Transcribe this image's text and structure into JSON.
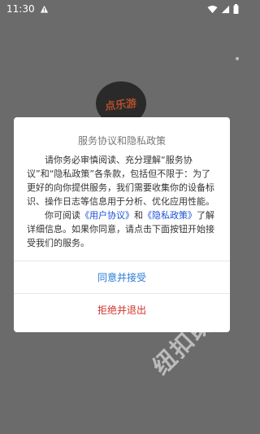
{
  "status_bar": {
    "time": "11:30",
    "icons": [
      "warning-icon",
      "wifi-icon",
      "signal-icon",
      "battery-icon"
    ]
  },
  "app": {
    "logo_text": "点乐游"
  },
  "dialog": {
    "title": "服务协议和隐私政策",
    "para1": "请你务必审慎阅读、充分理解“服务协议”和“隐私政策”各条款，包括但不限于：为了更好的向你提供服务，我们需要收集你的设备标识、操作日志等信息用于分析、优化应用性能。",
    "para2_prefix": "你可阅读",
    "user_agreement_link": "《用户协议》",
    "para2_and": "和",
    "privacy_policy_link": "《隐私政策》",
    "para2_suffix": "了解详细信息。如果你同意，请点击下面按钮开始接受我们的服务。",
    "agree_button": "同意并接受",
    "reject_button": "拒绝并退出"
  },
  "watermark": "纽扣助手",
  "colors": {
    "overlay": "#6b6b6b",
    "link": "#1a4fd6",
    "agree": "#2a7bd4",
    "reject": "#d0342c"
  }
}
